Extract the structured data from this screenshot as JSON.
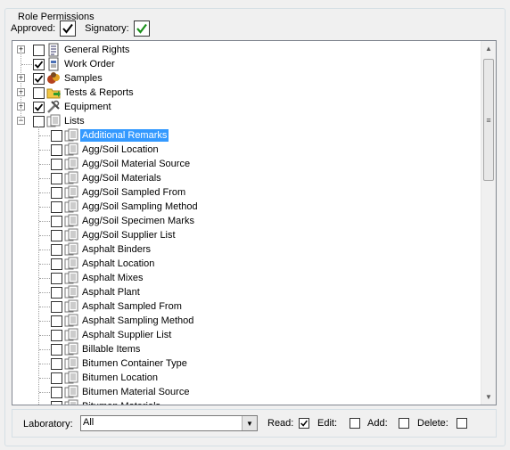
{
  "group_title": "Role Permissions",
  "flags": {
    "approved_label": "Approved:",
    "approved_checked": true,
    "signatory_label": "Signatory:",
    "signatory_checked": true
  },
  "tree": {
    "top_items": [
      {
        "label": "General Rights",
        "checked": false,
        "icon": "list-icon"
      },
      {
        "label": "Work Order",
        "checked": true,
        "icon": "document-icon"
      },
      {
        "label": "Samples",
        "checked": true,
        "icon": "samples-icon"
      },
      {
        "label": "Tests & Reports",
        "checked": false,
        "icon": "folder-arrow-icon"
      },
      {
        "label": "Equipment",
        "checked": true,
        "icon": "tools-icon"
      },
      {
        "label": "Lists",
        "checked": false,
        "icon": "lists-icon"
      }
    ],
    "list_items": [
      "Additional Remarks",
      "Agg/Soil Location",
      "Agg/Soil Material Source",
      "Agg/Soil Materials",
      "Agg/Soil Sampled From",
      "Agg/Soil Sampling Method",
      "Agg/Soil Specimen Marks",
      "Agg/Soil Supplier List",
      "Asphalt Binders",
      "Asphalt Location",
      "Asphalt Mixes",
      "Asphalt Plant",
      "Asphalt Sampled From",
      "Asphalt Sampling Method",
      "Asphalt Supplier List",
      "Billable Items",
      "Bitumen Container Type",
      "Bitumen Location",
      "Bitumen Material Source",
      "Bitumen Materials"
    ],
    "selected_item": "Additional Remarks"
  },
  "footer": {
    "laboratory_label": "Laboratory:",
    "laboratory_value": "All",
    "read_label": "Read:",
    "read_checked": true,
    "edit_label": "Edit:",
    "edit_checked": false,
    "add_label": "Add:",
    "add_checked": false,
    "delete_label": "Delete:",
    "delete_checked": false
  }
}
